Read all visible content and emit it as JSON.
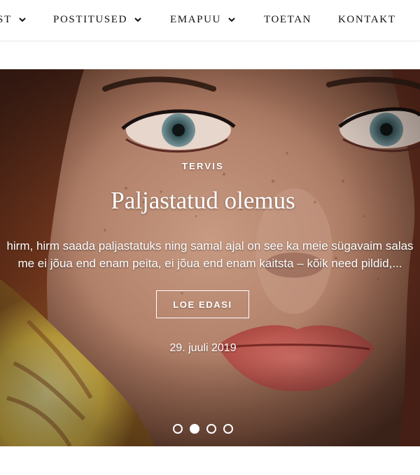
{
  "nav": {
    "items": [
      {
        "label": "ST",
        "has_dropdown": true
      },
      {
        "label": "POSTITUSED",
        "has_dropdown": true
      },
      {
        "label": "EMAPUU",
        "has_dropdown": true
      },
      {
        "label": "TOETAN",
        "has_dropdown": false
      },
      {
        "label": "KONTAKT",
        "has_dropdown": false
      }
    ]
  },
  "slider": {
    "category": "TERVIS",
    "title": "Paljastatud olemus",
    "excerpt_line1": "hirm, hirm saada paljastatuks ning samal ajal on see ka meie sügavaim salas",
    "excerpt_line2": "me ei jõua end enam peita, ei jõua end enam kaitsta – kõik need pildid,...",
    "read_more_label": "LOE EDASI",
    "date": "29. juuli 2019",
    "dot_count": 4,
    "active_dot": 2
  },
  "colors": {
    "nav_text": "#111111",
    "overlay_text": "#ffffff",
    "background": "#ffffff"
  },
  "icons": {
    "dropdown": "chevron-down-icon"
  }
}
